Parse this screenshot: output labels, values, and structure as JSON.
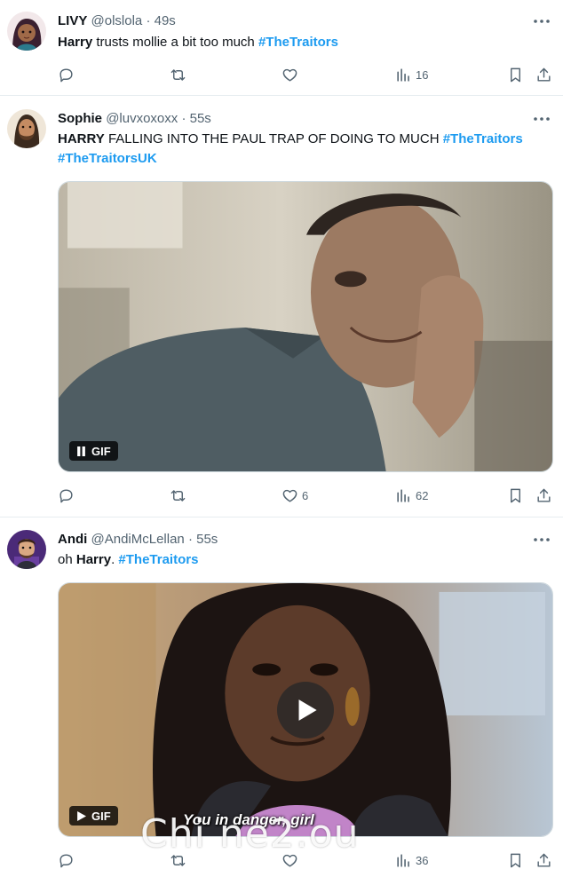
{
  "tweets": [
    {
      "name": "LIVY",
      "handle": "@olslola",
      "time": "49s",
      "text": [
        {
          "t": "b",
          "v": "Harry"
        },
        {
          "t": "p",
          "v": " trusts mollie a bit too much "
        },
        {
          "t": "tag",
          "v": "#TheTraitors"
        }
      ],
      "replies": "",
      "retweets": "",
      "likes": "",
      "views": "16"
    },
    {
      "name": "Sophie",
      "handle": "@luvxoxoxx",
      "time": "55s",
      "text": [
        {
          "t": "b",
          "v": "HARRY"
        },
        {
          "t": "p",
          "v": " FALLING INTO THE PAUL TRAP OF DOING TO MUCH "
        },
        {
          "t": "tag",
          "v": "#TheTraitors"
        },
        {
          "t": "p",
          "v": " "
        },
        {
          "t": "tag",
          "v": "#TheTraitorsUK"
        }
      ],
      "media_badge": "GIF",
      "replies": "",
      "retweets": "",
      "likes": "6",
      "views": "62"
    },
    {
      "name": "Andi",
      "handle": "@AndiMcLellan",
      "time": "55s",
      "text": [
        {
          "t": "p",
          "v": "oh "
        },
        {
          "t": "b",
          "v": "Harry"
        },
        {
          "t": "p",
          "v": ". "
        },
        {
          "t": "tag",
          "v": "#TheTraitors"
        }
      ],
      "media_badge": "GIF",
      "media_caption": "You in danger, girl",
      "replies": "",
      "retweets": "",
      "likes": "",
      "views": "36"
    }
  ],
  "separator": "·",
  "watermark": "Chi ne2.ou",
  "colors": {
    "link": "#1d9bf0",
    "secondary": "#536471",
    "divider": "#e6ecf0"
  },
  "icons": [
    "reply-icon",
    "retweet-icon",
    "like-icon",
    "views-icon",
    "bookmark-icon",
    "share-icon",
    "more-icon",
    "pause-icon",
    "play-icon"
  ]
}
